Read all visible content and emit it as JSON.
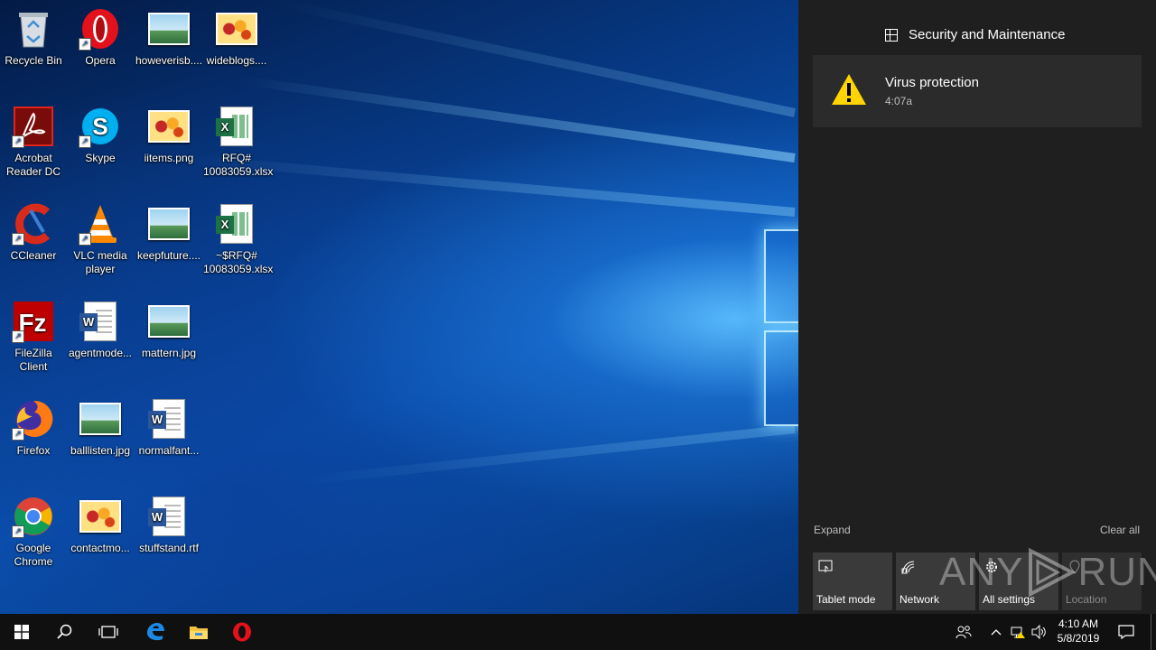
{
  "desktop": {
    "icons": [
      {
        "label": "Recycle Bin",
        "icon": "recycle-bin-icon"
      },
      {
        "label": "Opera",
        "icon": "opera-icon"
      },
      {
        "label": "howeverisb....",
        "icon": "image-file-icon"
      },
      {
        "label": "wideblogs....",
        "icon": "image-file-icon"
      },
      {
        "label": "Acrobat Reader DC",
        "icon": "acrobat-icon"
      },
      {
        "label": "Skype",
        "icon": "skype-icon"
      },
      {
        "label": "iitems.png",
        "icon": "image-file-icon"
      },
      {
        "label": "RFQ# 10083059.xlsx",
        "icon": "excel-file-icon"
      },
      {
        "label": "CCleaner",
        "icon": "ccleaner-icon"
      },
      {
        "label": "VLC media player",
        "icon": "vlc-icon"
      },
      {
        "label": "keepfuture....",
        "icon": "image-file-icon"
      },
      {
        "label": "~$RFQ# 10083059.xlsx",
        "icon": "excel-file-icon"
      },
      {
        "label": "FileZilla Client",
        "icon": "filezilla-icon"
      },
      {
        "label": "agentmode...",
        "icon": "word-file-icon"
      },
      {
        "label": "mattern.jpg",
        "icon": "image-file-icon"
      },
      {
        "label": "Firefox",
        "icon": "firefox-icon"
      },
      {
        "label": "balllisten.jpg",
        "icon": "image-file-icon"
      },
      {
        "label": "normalfant...",
        "icon": "word-file-icon"
      },
      {
        "label": "Google Chrome",
        "icon": "chrome-icon"
      },
      {
        "label": "contactmo...",
        "icon": "image-file-icon"
      },
      {
        "label": "stuffstand.rtf",
        "icon": "word-file-icon"
      }
    ]
  },
  "action_center": {
    "group_title": "Security and Maintenance",
    "notification": {
      "title": "Virus protection",
      "time": "4:07a"
    },
    "expand_label": "Expand",
    "clear_all_label": "Clear all",
    "quick_actions": [
      {
        "label": "Tablet mode",
        "icon": "tablet-mode-icon"
      },
      {
        "label": "Network",
        "icon": "network-icon"
      },
      {
        "label": "All settings",
        "icon": "gear-icon"
      },
      {
        "label": "Location",
        "icon": "location-icon"
      }
    ]
  },
  "watermark": {
    "text_left": "ANY",
    "text_right": "RUN"
  },
  "taskbar": {
    "pinned": [
      "start-icon",
      "search-icon",
      "task-view-icon",
      "edge-icon",
      "file-explorer-icon",
      "opera-icon"
    ],
    "clock": {
      "time": "4:10 AM",
      "date": "5/8/2019"
    }
  },
  "colors": {
    "accent": "#0a56b5",
    "panel_bg": "#1f1f1f",
    "taskbar_bg": "#101010",
    "warning": "#ffd400"
  }
}
